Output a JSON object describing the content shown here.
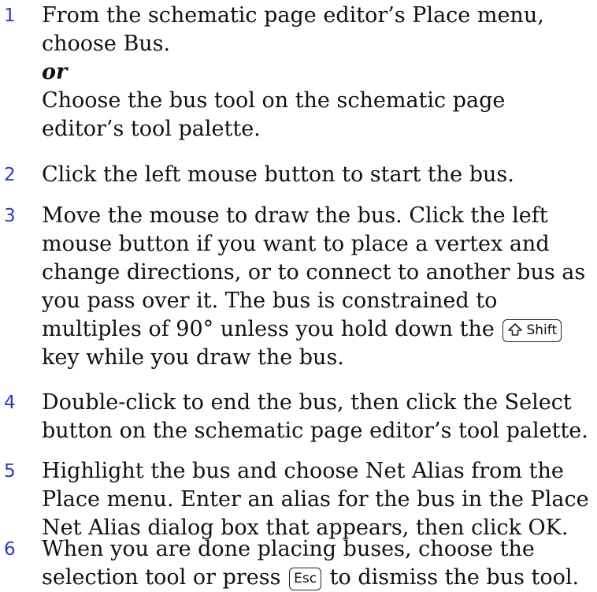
{
  "steps": [
    {
      "num": "1",
      "line1": "From the schematic page editor’s Place menu, choose Bus.",
      "or": "or",
      "line2": "Choose the bus tool on the schematic page editor’s tool palette."
    },
    {
      "num": "2",
      "text": "Click the left mouse button to start the bus."
    },
    {
      "num": "3",
      "text_before": "Move the mouse to draw the bus. Click the left mouse button if you want to place a vertex and change directions, or to connect to another bus as you pass over it. The bus is constrained to multiples of 90° unless you hold down the",
      "key": "Shift",
      "text_after": "key while you draw the bus."
    },
    {
      "num": "4",
      "text": "Double-click to end the bus, then click the Select button on the schematic page editor’s tool palette."
    },
    {
      "num": "5",
      "text": "Highlight the bus and choose Net Alias from the Place menu. Enter an alias for the bus in the Place Net Alias dialog box that appears, then click OK."
    },
    {
      "num": "6",
      "text_before": "When you are done placing buses, choose the selection tool or press",
      "key": "Esc",
      "text_after": "to dismiss the bus tool."
    }
  ],
  "icons": {
    "shift_key_icon": "shift-arrow-icon"
  },
  "colors": {
    "step_number": "#2a3dbb",
    "text": "#111111"
  }
}
